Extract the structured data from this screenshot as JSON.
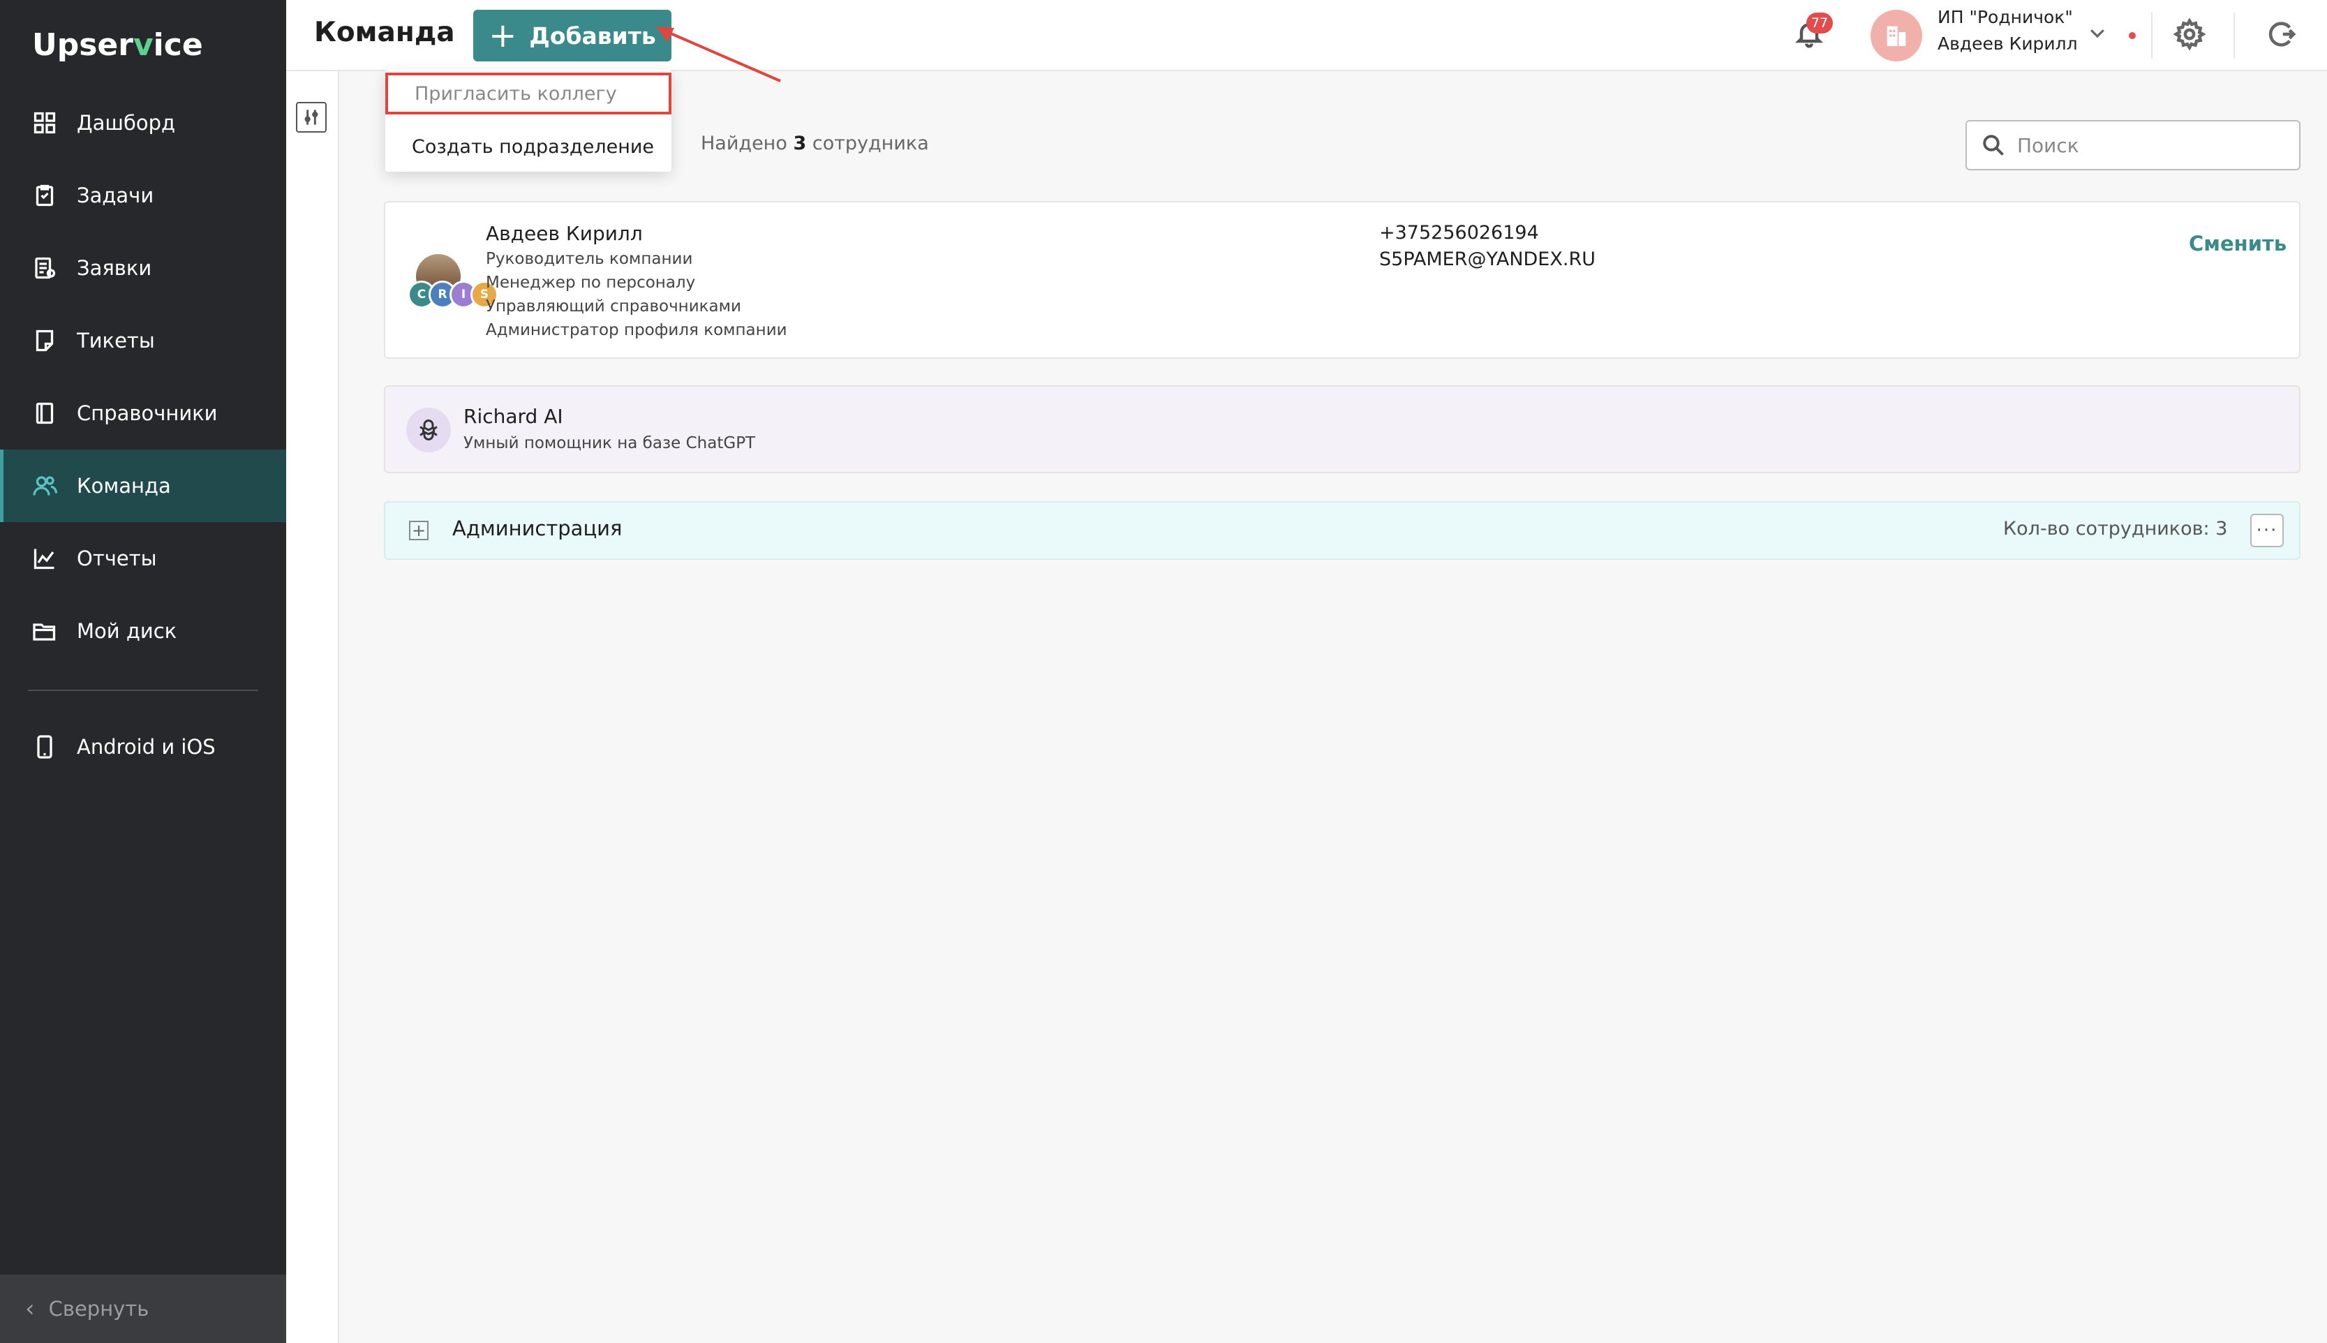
{
  "brand": {
    "name_part1": "Upser",
    "name_v": "v",
    "name_part2": "ice",
    "accent": "#3a8a8b"
  },
  "sidebar": {
    "items": [
      {
        "label": "Дашборд",
        "icon": "dashboard-icon"
      },
      {
        "label": "Задачи",
        "icon": "tasks-icon"
      },
      {
        "label": "Заявки",
        "icon": "requests-icon"
      },
      {
        "label": "Тикеты",
        "icon": "tickets-icon"
      },
      {
        "label": "Справочники",
        "icon": "directory-icon"
      },
      {
        "label": "Команда",
        "icon": "team-icon",
        "active": true
      },
      {
        "label": "Отчеты",
        "icon": "reports-icon"
      },
      {
        "label": "Мой диск",
        "icon": "folder-icon"
      }
    ],
    "extra_item": {
      "label": "Android и iOS",
      "icon": "mobile-icon"
    },
    "collapse_label": "Свернуть"
  },
  "header": {
    "title": "Команда",
    "add_button": "Добавить",
    "notifications_count": "77",
    "company_name": "ИП \"Родничок\"",
    "user_name": "Авдеев Кирилл"
  },
  "add_menu": {
    "items": [
      "Пригласить коллегу",
      "Создать подразделение"
    ]
  },
  "summary": {
    "prefix": "Найдено",
    "count": "3",
    "suffix": "сотрудника"
  },
  "search": {
    "placeholder": "Поиск",
    "value": ""
  },
  "employee": {
    "name": "Авдеев Кирилл",
    "roles": [
      "Руководитель компании",
      "Менеджер по персоналу",
      "Управляющий справочниками",
      "Администратор профиля компании"
    ],
    "role_badges": [
      {
        "letter": "C",
        "color": "#3a8a8b"
      },
      {
        "letter": "R",
        "color": "#4a7fc0"
      },
      {
        "letter": "I",
        "color": "#9a7fd0"
      },
      {
        "letter": "S",
        "color": "#e8a845"
      }
    ],
    "phone": "+375256026194",
    "email": "S5PAMER@YANDEX.RU",
    "action": "Сменить"
  },
  "assistant": {
    "name": "Richard AI",
    "description": "Умный помощник на базе ChatGPT"
  },
  "department": {
    "name": "Администрация",
    "count_label": "Кол-во сотрудников: 3"
  }
}
